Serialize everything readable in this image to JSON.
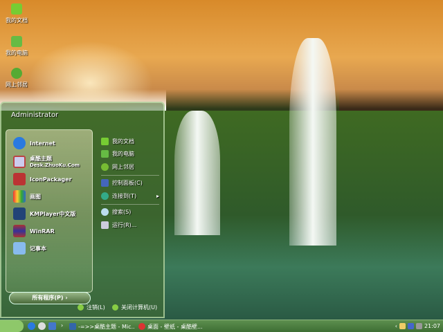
{
  "desktop": {
    "icons": [
      {
        "label": "我的文档",
        "icon": "folder-icon"
      },
      {
        "label": "我的电脑",
        "icon": "house-icon"
      },
      {
        "label": "网上邻居",
        "icon": "globe-icon"
      }
    ]
  },
  "start_menu": {
    "user": "Administrator",
    "programs": [
      {
        "title": "Internet",
        "icon": "ie-icon"
      },
      {
        "title": "桌酷主题",
        "subtitle": "Desk.ZhuoKu.Com",
        "icon": "theme-icon"
      },
      {
        "title": "IconPackager",
        "icon": "iconpackager-icon"
      },
      {
        "title": "画图",
        "icon": "paint-icon"
      },
      {
        "title": "KMPlayer中文版",
        "icon": "kmplayer-icon"
      },
      {
        "title": "WinRAR",
        "icon": "winrar-icon"
      },
      {
        "title": "记事本",
        "icon": "notepad-icon"
      }
    ],
    "all_programs": "所有程序(P)",
    "places": [
      {
        "label": "我的文档",
        "icon": "folder-icon"
      },
      {
        "label": "我的电脑",
        "icon": "house-icon"
      },
      {
        "label": "网上邻居",
        "icon": "globe-icon"
      },
      {
        "label": "控制面板(C)",
        "icon": "control-panel-icon"
      },
      {
        "label": "连接到(T)",
        "icon": "connect-icon"
      },
      {
        "label": "搜索(S)",
        "icon": "search-icon"
      },
      {
        "label": "运行(R)...",
        "icon": "run-icon"
      }
    ],
    "logoff": "注销(L)",
    "shutdown": "关闭计算机(U)"
  },
  "taskbar": {
    "tasks": [
      {
        "label": "-=>>桌酷主题 - Mic..."
      },
      {
        "label": "桌面 - 壁纸 - 桌酷壁..."
      }
    ],
    "clock": "21:07",
    "colors": {
      "bar": "#3d6e34",
      "start": "#8ec86a"
    }
  }
}
